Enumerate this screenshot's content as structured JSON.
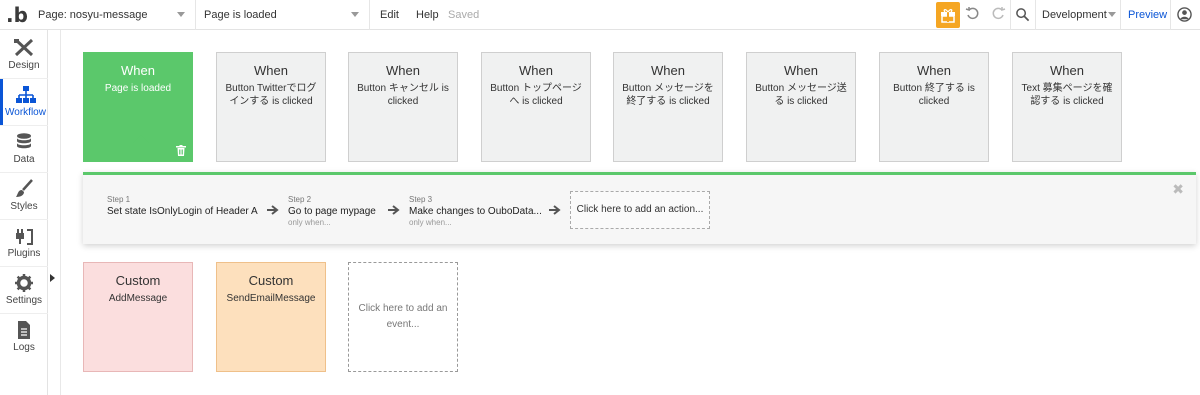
{
  "topbar": {
    "logo": "b",
    "page_select": "Page: nosyu-message",
    "event_select": "Page is loaded",
    "edit": "Edit",
    "help": "Help",
    "saved": "Saved",
    "env_select": "Development",
    "preview": "Preview",
    "accent": "#0a55d6"
  },
  "sidebar": {
    "items": [
      {
        "label": "Design",
        "icon": "design-icon"
      },
      {
        "label": "Workflow",
        "icon": "workflow-icon"
      },
      {
        "label": "Data",
        "icon": "data-icon"
      },
      {
        "label": "Styles",
        "icon": "styles-icon"
      },
      {
        "label": "Plugins",
        "icon": "plugins-icon"
      },
      {
        "label": "Settings",
        "icon": "settings-icon"
      },
      {
        "label": "Logs",
        "icon": "logs-icon"
      }
    ]
  },
  "events": [
    {
      "head": "When",
      "body": "Page is loaded"
    },
    {
      "head": "When",
      "body": "Button Twitterでログインする is clicked"
    },
    {
      "head": "When",
      "body": "Button キャンセル is clicked"
    },
    {
      "head": "When",
      "body": "Button トップページへ is clicked"
    },
    {
      "head": "When",
      "body": "Button メッセージを終了する is clicked"
    },
    {
      "head": "When",
      "body": "Button メッセージ送る is clicked"
    },
    {
      "head": "When",
      "body": "Button 終了する is clicked"
    },
    {
      "head": "When",
      "body": "Text 募集ページを確認する is clicked"
    }
  ],
  "steps": [
    {
      "num": "Step 1",
      "title": "Set state IsOnlyLogin of Header A",
      "cond": ""
    },
    {
      "num": "Step 2",
      "title": "Go to page mypage",
      "cond": "only when..."
    },
    {
      "num": "Step 3",
      "title": "Make changes to OuboData...",
      "cond": "only when..."
    }
  ],
  "add_action": "Click here to add an action...",
  "custom_events": [
    {
      "head": "Custom",
      "body": "AddMessage"
    },
    {
      "head": "Custom",
      "body": "SendEmailMessage"
    }
  ],
  "add_event": "Click here to add an event..."
}
